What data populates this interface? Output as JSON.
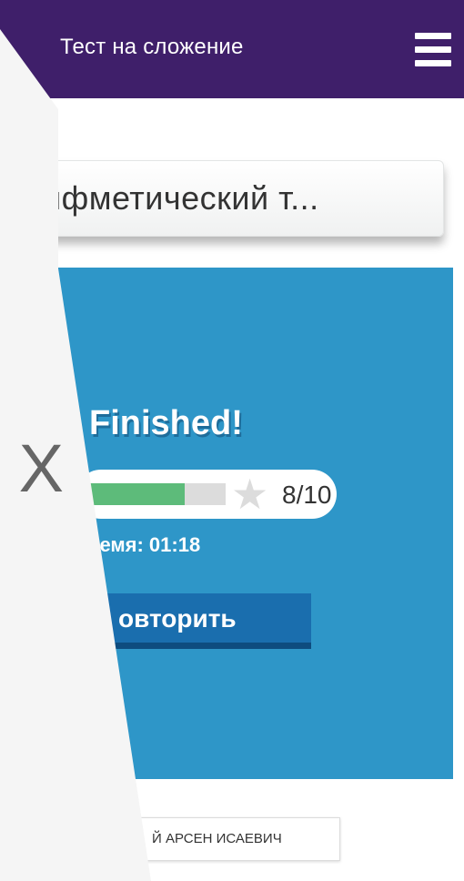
{
  "header": {
    "title": "Тест на сложение"
  },
  "card_title": "ифметический т...",
  "result": {
    "heading": "Finished!",
    "score_text": "8/10",
    "progress_fraction": 0.7,
    "time_text": "ремя: 01:18",
    "retry_label": "овторить"
  },
  "footer": {
    "student_name": "Й АРСЕН ИСАЕВИЧ"
  },
  "overlay": {
    "close_glyph": "X"
  },
  "icons": {
    "menu": "hamburger-menu-icon",
    "star": "star-icon",
    "close": "close-icon"
  },
  "colors": {
    "topbar": "#3f1f6a",
    "panel": "#2e96c8",
    "button": "#1a6eae",
    "progress": "#5dbb7a"
  }
}
